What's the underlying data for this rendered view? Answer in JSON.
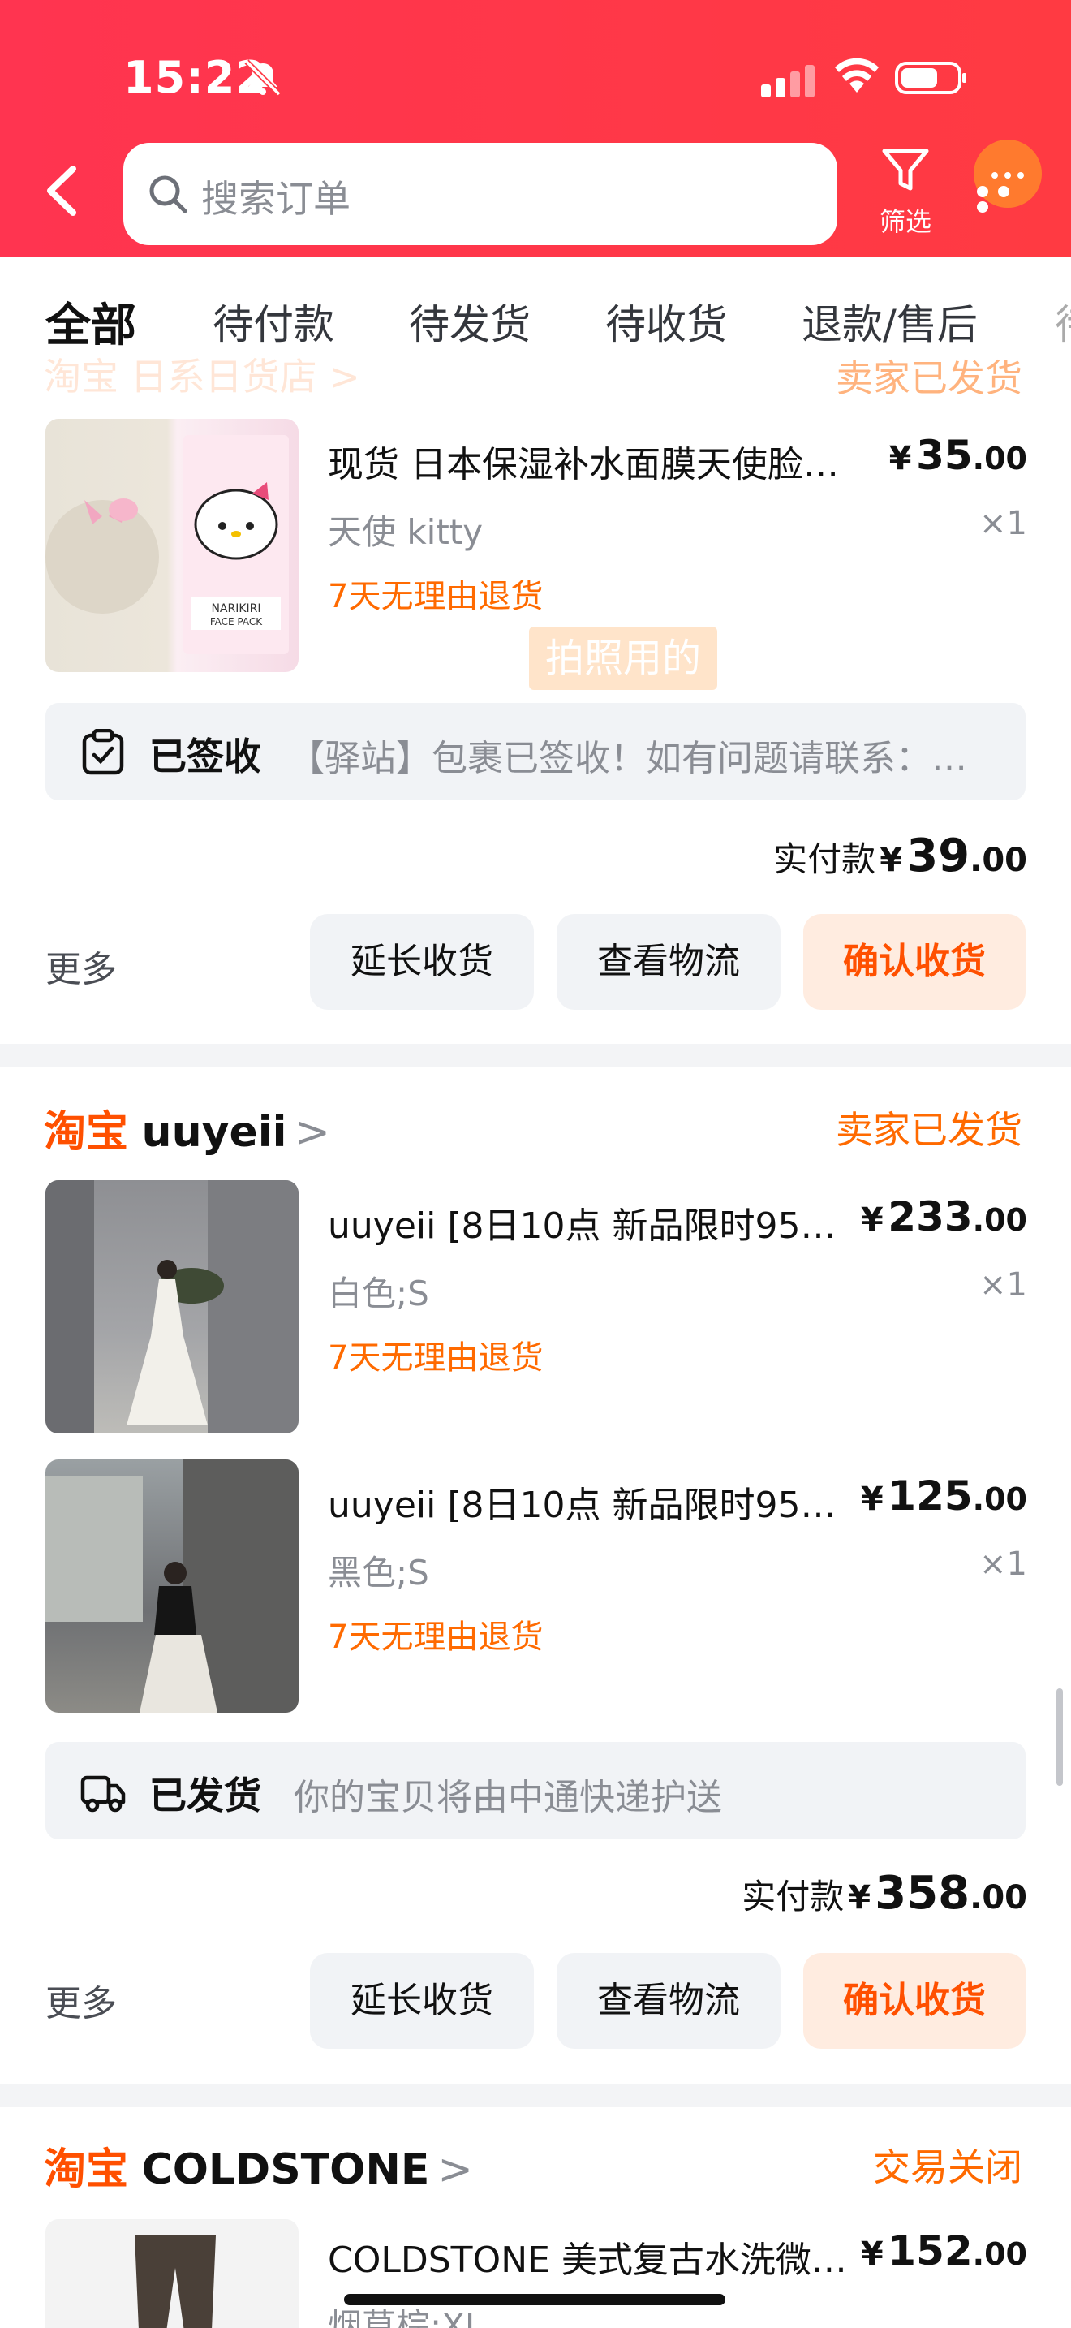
{
  "status_bar": {
    "time": "15:22"
  },
  "header": {
    "search_placeholder": "搜索订单",
    "filter_label": "筛选"
  },
  "tabs": [
    "全部",
    "待付款",
    "待发货",
    "待收货",
    "退款/售后"
  ],
  "order1": {
    "store_partial": "淘宝 日系日货店 >",
    "status_partial": "卖家已发货",
    "item": {
      "title": "现货 日本保湿补水面膜天使脸…",
      "price_int": "35",
      "price_dec": ".00",
      "sku": "天使 kitty",
      "qty": "×1",
      "return": "7天无理由退货"
    },
    "stamp": "拍照用的",
    "logistics": {
      "label": "已签收",
      "desc": "【驿站】包裹已签收！如有问题请联系：…"
    },
    "total": {
      "label": "实付款",
      "int": "39",
      "dec": ".00"
    },
    "more": "更多",
    "btn_extend": "延长收货",
    "btn_track": "查看物流",
    "btn_confirm": "确认收货"
  },
  "order2": {
    "store_brand": "淘宝",
    "store_name": "uuyeii",
    "status": "卖家已发货",
    "items": [
      {
        "title": "uuyeii [8日10点  新品限时95…",
        "price_int": "233",
        "price_dec": ".00",
        "sku": "白色;S",
        "qty": "×1",
        "return": "7天无理由退货"
      },
      {
        "title": "uuyeii [8日10点  新品限时95…",
        "price_int": "125",
        "price_dec": ".00",
        "sku": "黑色;S",
        "qty": "×1",
        "return": "7天无理由退货"
      }
    ],
    "logistics": {
      "label": "已发货",
      "desc": "你的宝贝将由中通快递护送"
    },
    "total": {
      "label": "实付款",
      "int": "358",
      "dec": ".00"
    },
    "more": "更多",
    "btn_extend": "延长收货",
    "btn_track": "查看物流",
    "btn_confirm": "确认收货"
  },
  "order3": {
    "store_brand": "淘宝",
    "store_name": "COLDSTONE",
    "status": "交易关闭",
    "item": {
      "title": "COLDSTONE 美式复古水洗微…",
      "price_int": "152",
      "price_dec": ".00",
      "sku": "烟草棕;XL"
    }
  },
  "currency": "¥",
  "colors": {
    "header": "#ff3a46",
    "accent": "#ff5000",
    "status": "#ff6a00"
  }
}
